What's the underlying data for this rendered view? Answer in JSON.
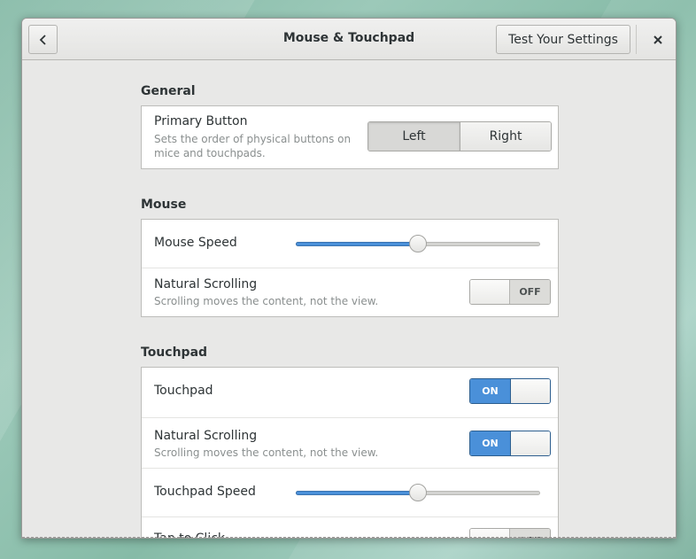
{
  "header": {
    "title": "Mouse & Touchpad",
    "test_button": "Test Your Settings"
  },
  "general": {
    "section_title": "General",
    "primary_button": {
      "label": "Primary Button",
      "description": "Sets the order of physical buttons on mice and touchpads.",
      "options": [
        "Left",
        "Right"
      ],
      "selected": "Left"
    }
  },
  "mouse": {
    "section_title": "Mouse",
    "speed": {
      "label": "Mouse Speed",
      "value": 0.5
    },
    "natural_scrolling": {
      "label": "Natural Scrolling",
      "description": "Scrolling moves the content, not the view.",
      "state": "OFF"
    }
  },
  "touchpad": {
    "section_title": "Touchpad",
    "touchpad": {
      "label": "Touchpad",
      "state": "ON"
    },
    "natural_scrolling": {
      "label": "Natural Scrolling",
      "description": "Scrolling moves the content, not the view.",
      "state": "ON"
    },
    "speed": {
      "label": "Touchpad Speed",
      "value": 0.5
    },
    "tap_to_click": {
      "label": "Tap to Click",
      "state": "OFF"
    }
  },
  "colors": {
    "accent": "#4a90d9",
    "window_bg": "#e8e8e7"
  }
}
